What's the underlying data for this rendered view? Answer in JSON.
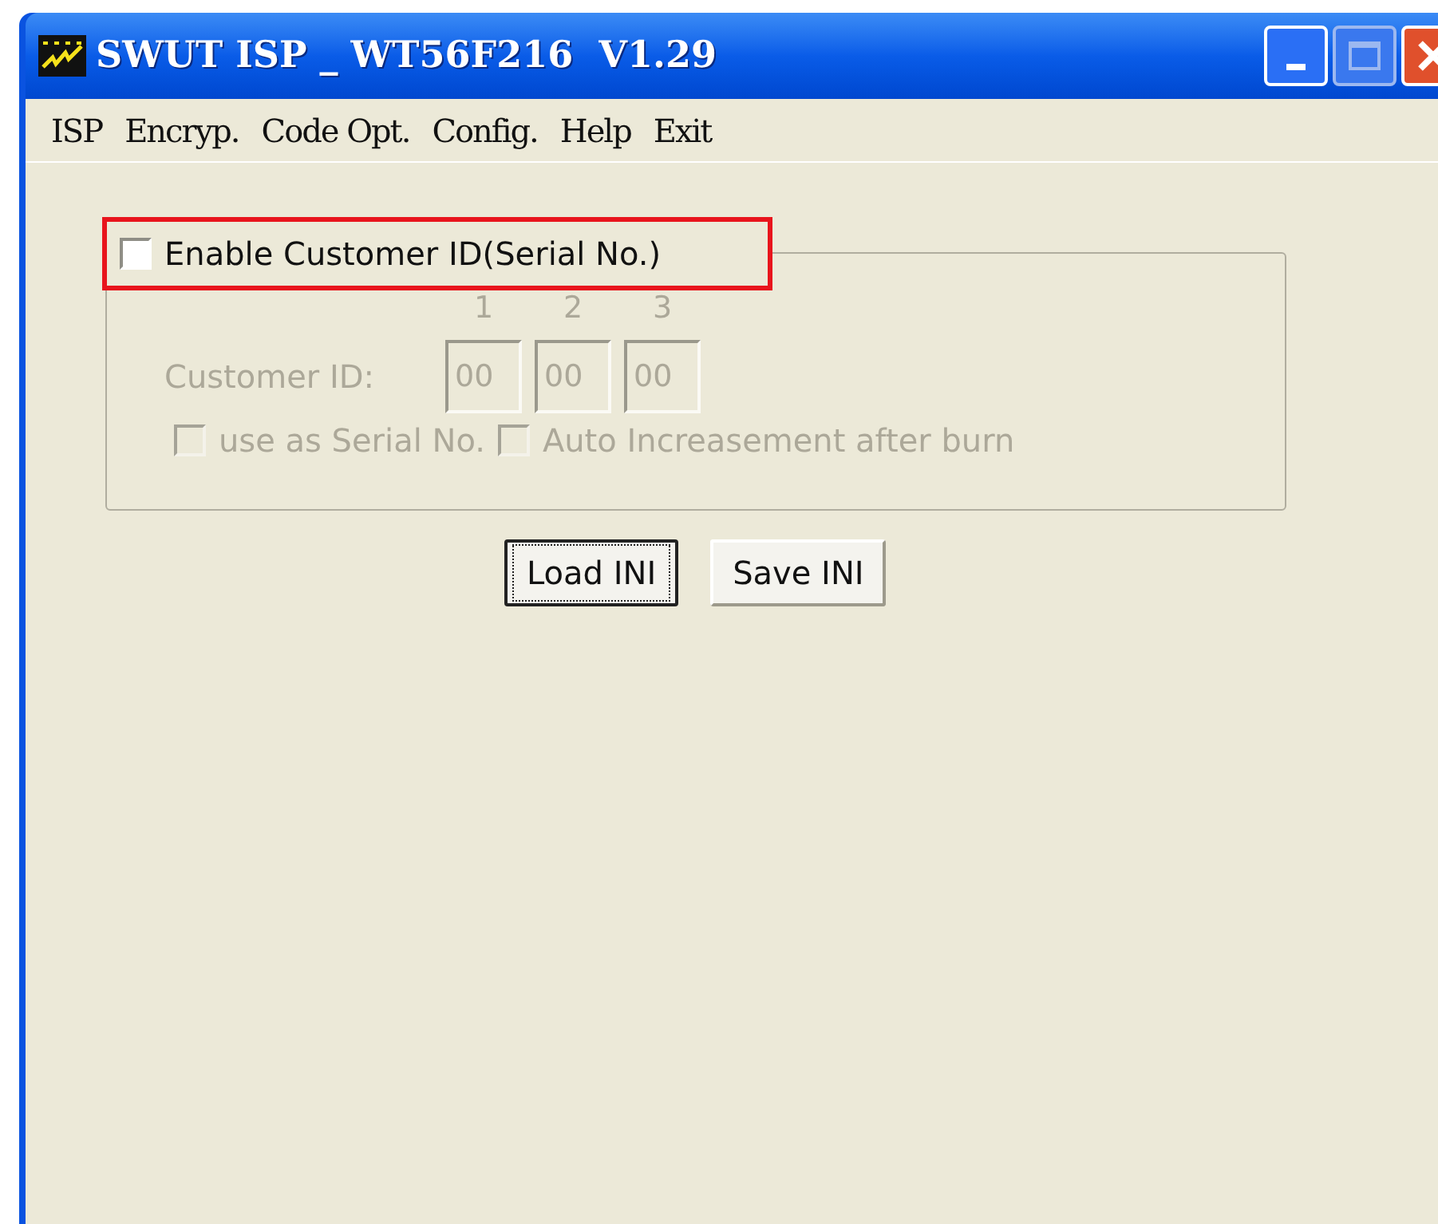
{
  "window": {
    "title": "SWUT ISP _ WT56F216  V1.29"
  },
  "menu": [
    "ISP",
    "Encryp.",
    "Code Opt.",
    "Config.",
    "Help",
    "Exit"
  ],
  "customer_id_group": {
    "enable": {
      "label": "Enable Customer ID(Serial No.)",
      "checked": false
    },
    "column_numbers": [
      "1",
      "2",
      "3"
    ],
    "id_label": "Customer ID:",
    "id_fields": [
      "00",
      "00",
      "00"
    ],
    "disabled": true,
    "options": [
      {
        "label": "use as Serial No.",
        "checked": false
      },
      {
        "label": "Auto Increasement after burn",
        "checked": false
      }
    ]
  },
  "buttons": [
    {
      "label": "Load INI",
      "focused": true
    },
    {
      "label": "Save INI",
      "focused": false
    }
  ]
}
